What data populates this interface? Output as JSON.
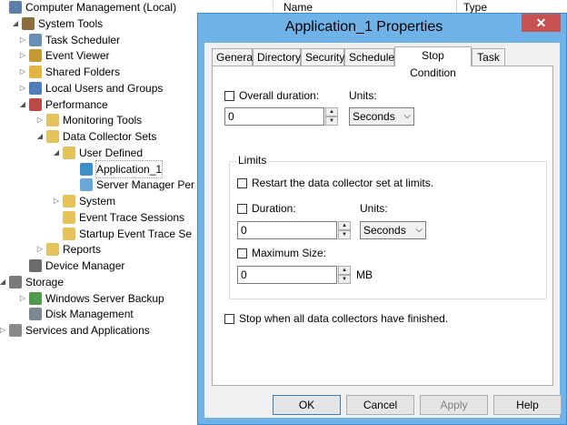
{
  "tree": {
    "items": [
      {
        "label": "Computer Management (Local)",
        "icon": "computer-icon",
        "expander": ""
      },
      {
        "label": "System Tools",
        "icon": "tools-icon",
        "expander": "◢"
      },
      {
        "label": "Task Scheduler",
        "icon": "clock-icon",
        "expander": "▷"
      },
      {
        "label": "Event Viewer",
        "icon": "event-viewer-icon",
        "expander": "▷"
      },
      {
        "label": "Shared Folders",
        "icon": "shared-folder-icon",
        "expander": "▷"
      },
      {
        "label": "Local Users and Groups",
        "icon": "users-icon",
        "expander": "▷"
      },
      {
        "label": "Performance",
        "icon": "performance-icon",
        "expander": "◢"
      },
      {
        "label": "Monitoring Tools",
        "icon": "folder-icon",
        "expander": "▷"
      },
      {
        "label": "Data Collector Sets",
        "icon": "folder-icon",
        "expander": "◢"
      },
      {
        "label": "User Defined",
        "icon": "user-folder-icon",
        "expander": "◢"
      },
      {
        "label": "Application_1",
        "icon": "collector-set-running-icon",
        "expander": ""
      },
      {
        "label": "Server Manager Per",
        "icon": "collector-set-icon",
        "expander": ""
      },
      {
        "label": "System",
        "icon": "system-folder-icon",
        "expander": "▷"
      },
      {
        "label": "Event Trace Sessions",
        "icon": "trace-icon",
        "expander": ""
      },
      {
        "label": "Startup Event Trace Se",
        "icon": "trace-icon",
        "expander": ""
      },
      {
        "label": "Reports",
        "icon": "folder-icon",
        "expander": "▷"
      },
      {
        "label": "Device Manager",
        "icon": "device-manager-icon",
        "expander": ""
      },
      {
        "label": "Storage",
        "icon": "storage-icon",
        "expander": "◢"
      },
      {
        "label": "Windows Server Backup",
        "icon": "backup-icon",
        "expander": "▷"
      },
      {
        "label": "Disk Management",
        "icon": "disk-icon",
        "expander": ""
      },
      {
        "label": "Services and Applications",
        "icon": "services-icon",
        "expander": "▷"
      }
    ]
  },
  "list_header": {
    "name": "Name",
    "type": "Type"
  },
  "dialog": {
    "title": "Application_1 Properties",
    "close_glyph": "✕",
    "tabs": [
      "General",
      "Directory",
      "Security",
      "Schedule",
      "Stop Condition",
      "Task"
    ],
    "active_tab": "Stop Condition",
    "overall_duration": {
      "label": "Overall duration:",
      "checked": false,
      "value": "0",
      "units_label": "Units:",
      "units": "Seconds"
    },
    "limits": {
      "group_label": "Limits",
      "restart_label": "Restart the data collector set at limits.",
      "duration": {
        "label": "Duration:",
        "checked": false,
        "value": "0",
        "units_label": "Units:",
        "units": "Seconds"
      },
      "max_size": {
        "label": "Maximum Size:",
        "checked": false,
        "value": "0",
        "unit": "MB"
      }
    },
    "stop_all_label": "Stop when all data collectors have finished.",
    "buttons": {
      "ok": "OK",
      "cancel": "Cancel",
      "apply": "Apply",
      "help": "Help"
    }
  },
  "colors": {
    "title_bar": "#6fb2e8",
    "close_button": "#c75050",
    "panel": "#ffffff",
    "client": "#f0f0f0"
  }
}
